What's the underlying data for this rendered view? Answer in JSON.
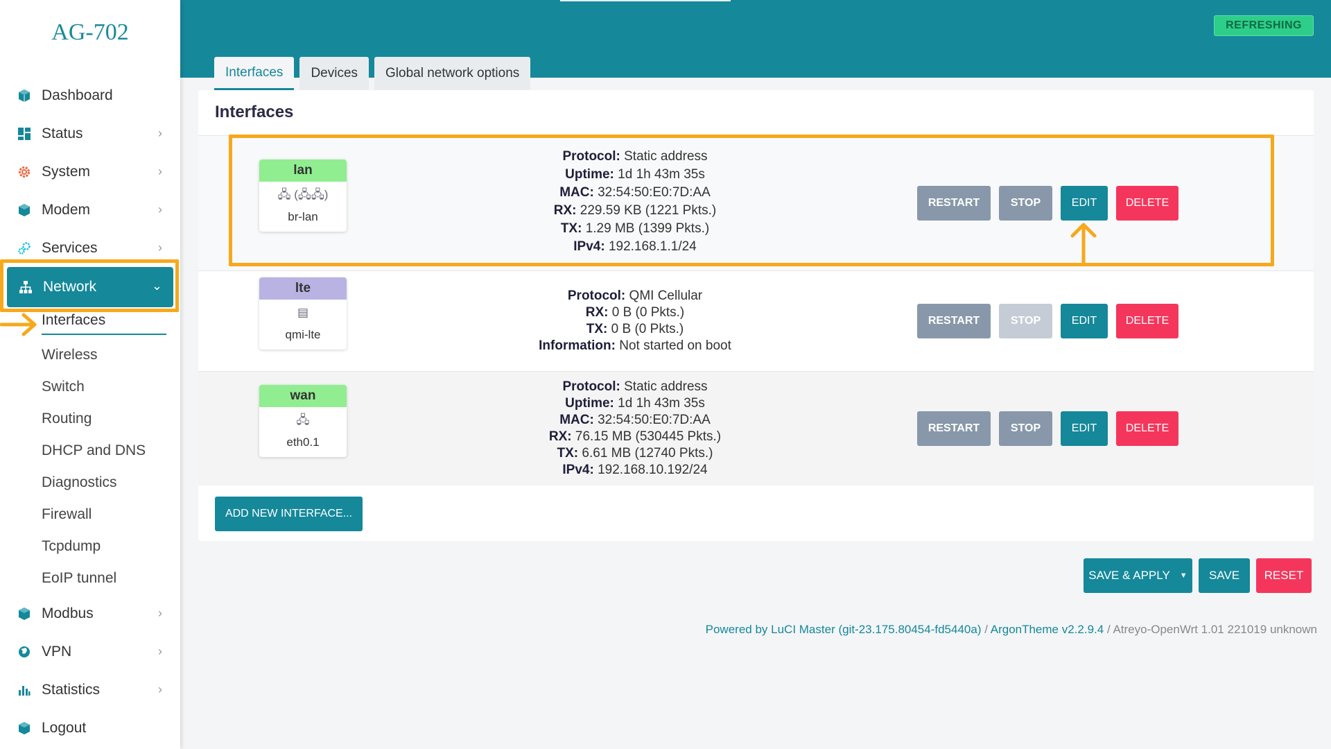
{
  "brand": "AG-702",
  "sidebar": {
    "items": [
      {
        "label": "Dashboard",
        "icon": "cube-icon"
      },
      {
        "label": "Status",
        "icon": "grid-icon"
      },
      {
        "label": "System",
        "icon": "gear-icon"
      },
      {
        "label": "Modem",
        "icon": "cube-icon"
      },
      {
        "label": "Services",
        "icon": "gears-icon"
      },
      {
        "label": "Network",
        "icon": "network-icon"
      },
      {
        "label": "Modbus",
        "icon": "cube-icon"
      },
      {
        "label": "VPN",
        "icon": "globe-icon"
      },
      {
        "label": "Statistics",
        "icon": "bar-chart-icon"
      },
      {
        "label": "Logout",
        "icon": "cube-icon"
      }
    ],
    "network_sub": [
      "Interfaces",
      "Wireless",
      "Switch",
      "Routing",
      "DHCP and DNS",
      "Diagnostics",
      "Firewall",
      "Tcpdump",
      "EoIP tunnel"
    ]
  },
  "header": {
    "status": "REFRESHING",
    "tabs": [
      "Interfaces",
      "Devices",
      "Global network options"
    ]
  },
  "main": {
    "title": "Interfaces",
    "interfaces": [
      {
        "name": "lan",
        "device": "br-lan",
        "icon_text": "🖧 (🖧🖧)",
        "header_color": "#90ee90",
        "details": [
          {
            "k": "Protocol:",
            "v": "Static address"
          },
          {
            "k": "Uptime:",
            "v": "1d 1h 43m 35s"
          },
          {
            "k": "MAC:",
            "v": "32:54:50:E0:7D:AA"
          },
          {
            "k": "RX:",
            "v": "229.59 KB (1221 Pkts.)"
          },
          {
            "k": "TX:",
            "v": "1.29 MB (1399 Pkts.)"
          },
          {
            "k": "IPv4:",
            "v": "192.168.1.1/24"
          }
        ]
      },
      {
        "name": "lte",
        "device": "qmi-lte",
        "icon_text": "▤",
        "header_color": "#b9b3e3",
        "details": [
          {
            "k": "Protocol:",
            "v": "QMI Cellular"
          },
          {
            "k": "RX:",
            "v": "0 B (0 Pkts.)"
          },
          {
            "k": "TX:",
            "v": "0 B (0 Pkts.)"
          },
          {
            "k": "Information:",
            "v": "Not started on boot"
          }
        ]
      },
      {
        "name": "wan",
        "device": "eth0.1",
        "icon_text": "🖧",
        "header_color": "#90ee90",
        "details": [
          {
            "k": "Protocol:",
            "v": "Static address"
          },
          {
            "k": "Uptime:",
            "v": "1d 1h 43m 35s"
          },
          {
            "k": "MAC:",
            "v": "32:54:50:E0:7D:AA"
          },
          {
            "k": "RX:",
            "v": "76.15 MB (530445 Pkts.)"
          },
          {
            "k": "TX:",
            "v": "6.61 MB (12740 Pkts.)"
          },
          {
            "k": "IPv4:",
            "v": "192.168.10.192/24"
          }
        ]
      }
    ],
    "row_buttons": {
      "restart": "RESTART",
      "stop": "STOP",
      "edit": "EDIT",
      "delete": "DELETE"
    },
    "add_button": "ADD NEW INTERFACE..."
  },
  "actions": {
    "save_apply": "SAVE & APPLY",
    "save": "SAVE",
    "reset": "RESET"
  },
  "footer": {
    "luci": "Powered by LuCI Master (git-23.175.80454-fd5440a)",
    "sep1": " / ",
    "theme": "ArgonTheme v2.2.9.4",
    "sep2": " / ",
    "build": "Atreyo-OpenWrt 1.01 221019 unknown"
  },
  "colors": {
    "accent": "#15889a",
    "danger": "#f5365c",
    "muted": "#8898aa",
    "success": "#2dce89",
    "annotation": "#f7a81b"
  }
}
